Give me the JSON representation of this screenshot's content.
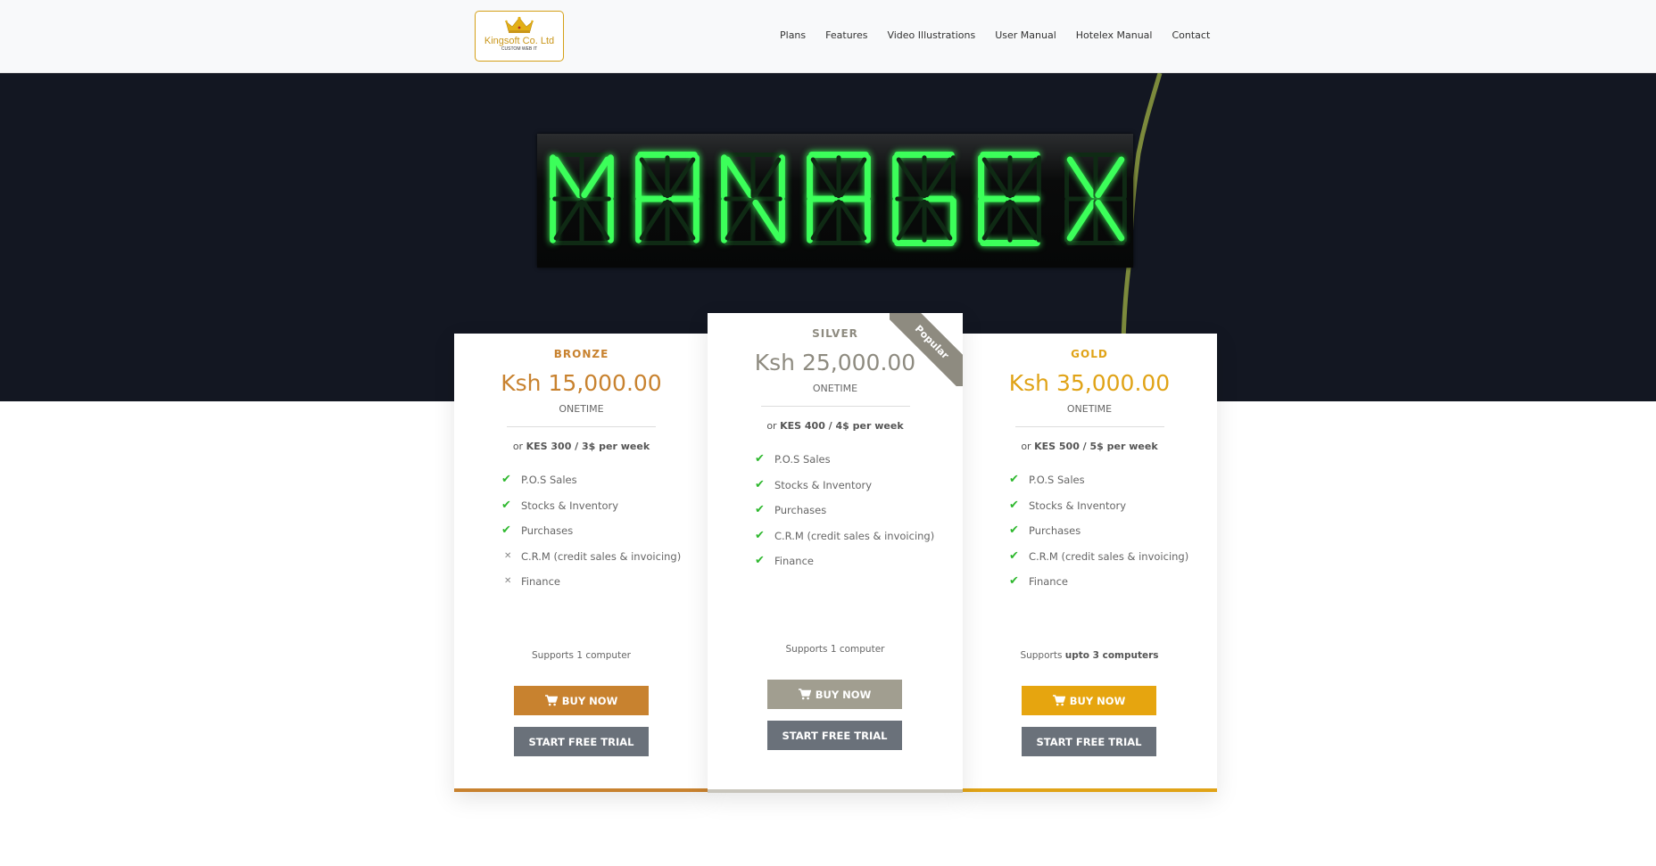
{
  "header": {
    "logo": {
      "brand": "Kingsoft Co. Ltd",
      "tagline": "CUSTOM WEB IT"
    },
    "nav": [
      "Plans",
      "Features",
      "Video Illustrations",
      "User Manual",
      "Hotelex Manual",
      "Contact"
    ]
  },
  "hero": {
    "display_text": "MANAGEX",
    "display_color": "#3cff5a"
  },
  "plans": [
    {
      "name": "BRONZE",
      "price": "Ksh 15,000.00",
      "period": "ONETIME",
      "weekly_prefix": "or",
      "weekly_value": "KES 300 / 3$ per week",
      "features": [
        {
          "label": "P.O.S Sales",
          "included": true
        },
        {
          "label": "Stocks & Inventory",
          "included": true
        },
        {
          "label": "Purchases",
          "included": true
        },
        {
          "label": "C.R.M (credit sales & invoicing)",
          "included": false
        },
        {
          "label": "Finance",
          "included": false
        }
      ],
      "supports_prefix": "Supports",
      "supports_value": "1 computer",
      "buy_label": "BUY NOW",
      "trial_label": "START FREE TRIAL",
      "accent": "#c8822f"
    },
    {
      "name": "SILVER",
      "badge": "Popular",
      "price": "Ksh 25,000.00",
      "period": "ONETIME",
      "weekly_prefix": "or",
      "weekly_value": "KES 400 / 4$ per week",
      "features": [
        {
          "label": "P.O.S Sales",
          "included": true
        },
        {
          "label": "Stocks & Inventory",
          "included": true
        },
        {
          "label": "Purchases",
          "included": true
        },
        {
          "label": "C.R.M (credit sales & invoicing)",
          "included": true
        },
        {
          "label": "Finance",
          "included": true
        }
      ],
      "supports_prefix": "Supports",
      "supports_value": "1 computer",
      "buy_label": "BUY NOW",
      "trial_label": "START FREE TRIAL",
      "accent": "#8e8b80"
    },
    {
      "name": "GOLD",
      "price": "Ksh 35,000.00",
      "period": "ONETIME",
      "weekly_prefix": "or",
      "weekly_value": "KES 500 / 5$ per week",
      "features": [
        {
          "label": "P.O.S Sales",
          "included": true
        },
        {
          "label": "Stocks & Inventory",
          "included": true
        },
        {
          "label": "Purchases",
          "included": true
        },
        {
          "label": "C.R.M (credit sales & invoicing)",
          "included": true
        },
        {
          "label": "Finance",
          "included": true
        }
      ],
      "supports_prefix": "Supports",
      "supports_value": "upto 3 computers",
      "buy_label": "BUY NOW",
      "trial_label": "START FREE TRIAL",
      "accent": "#e0a317"
    }
  ],
  "icons": {
    "included": "check-icon",
    "excluded": "cross-icon",
    "buy": "cart-icon"
  }
}
